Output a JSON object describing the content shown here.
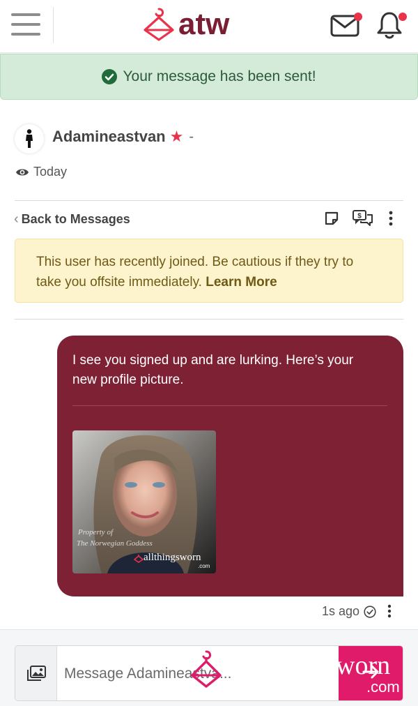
{
  "header": {
    "logo_text": "atw",
    "mail_has_notification": true,
    "bell_has_notification": true
  },
  "alert": {
    "success_text": "Your message has been sent!"
  },
  "conversation": {
    "username": "Adamineastvan",
    "username_suffix": "-",
    "last_seen": "Today"
  },
  "toolbar": {
    "back_label": "Back to Messages"
  },
  "warning": {
    "text": "This user has recently joined. Be cautious if they try to take you offsite immediately.",
    "link_label": "Learn More"
  },
  "message": {
    "text": "I see you signed up and are lurking. Here’s your new profile picture.",
    "timestamp": "1s ago",
    "image_watermark": {
      "line1": "Property of",
      "line2": "The Norwegian Goddess",
      "brand": "allthingsworn",
      "domain": ".com"
    }
  },
  "composer": {
    "placeholder": "Message Adamineastva...",
    "send_watermark_top": "worn",
    "send_watermark_bottom": ".com"
  },
  "colors": {
    "brand": "#7a1f33",
    "bubble": "#7f2134",
    "accent_pink": "#e01b6a",
    "notification_dot": "#e8334a",
    "success_bg": "#d5ebd9",
    "warning_bg": "#fdf3cc"
  }
}
